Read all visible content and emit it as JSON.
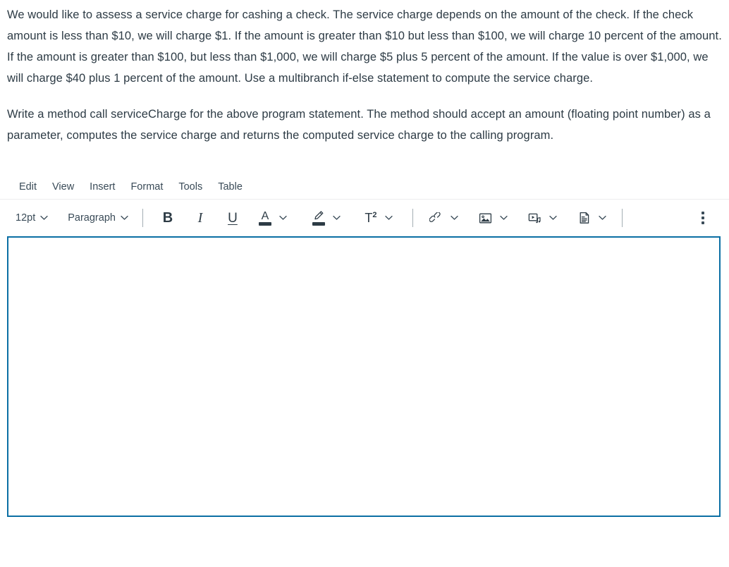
{
  "question": {
    "paragraph_1": "We would like to assess a service charge for cashing a check. The service charge depends on the amount of the check. If the check amount is less than $10, we will charge $1. If the amount is greater than $10 but less than $100, we will charge 10 percent of the amount.  If the amount is greater than $100, but less than $1,000, we will charge $5 plus 5 percent of the amount.  If the value is over $1,000, we will charge $40 plus 1 percent of the amount.  Use a multibranch if-else statement to compute the service charge.",
    "paragraph_2": "Write a method call serviceCharge for the above program statement.  The method should accept an amount (floating point number) as a parameter, computes the service charge and returns the computed service charge to the calling program."
  },
  "editor": {
    "menubar": [
      {
        "label": "Edit",
        "name": "menu-edit"
      },
      {
        "label": "View",
        "name": "menu-view"
      },
      {
        "label": "Insert",
        "name": "menu-insert"
      },
      {
        "label": "Format",
        "name": "menu-format"
      },
      {
        "label": "Tools",
        "name": "menu-tools"
      },
      {
        "label": "Table",
        "name": "menu-table"
      }
    ],
    "toolbar": {
      "font_size": "12pt",
      "block_format": "Paragraph",
      "bold_label": "B",
      "italic_label": "I",
      "underline_label": "U",
      "text_color_label": "A",
      "superscript_label": "T",
      "superscript_exponent": "2",
      "text_color_swatch": "#2d3b45",
      "highlight_color_swatch": "#2d3b45"
    },
    "content": "",
    "placeholder": "",
    "border_color": "#0b6fa4"
  }
}
